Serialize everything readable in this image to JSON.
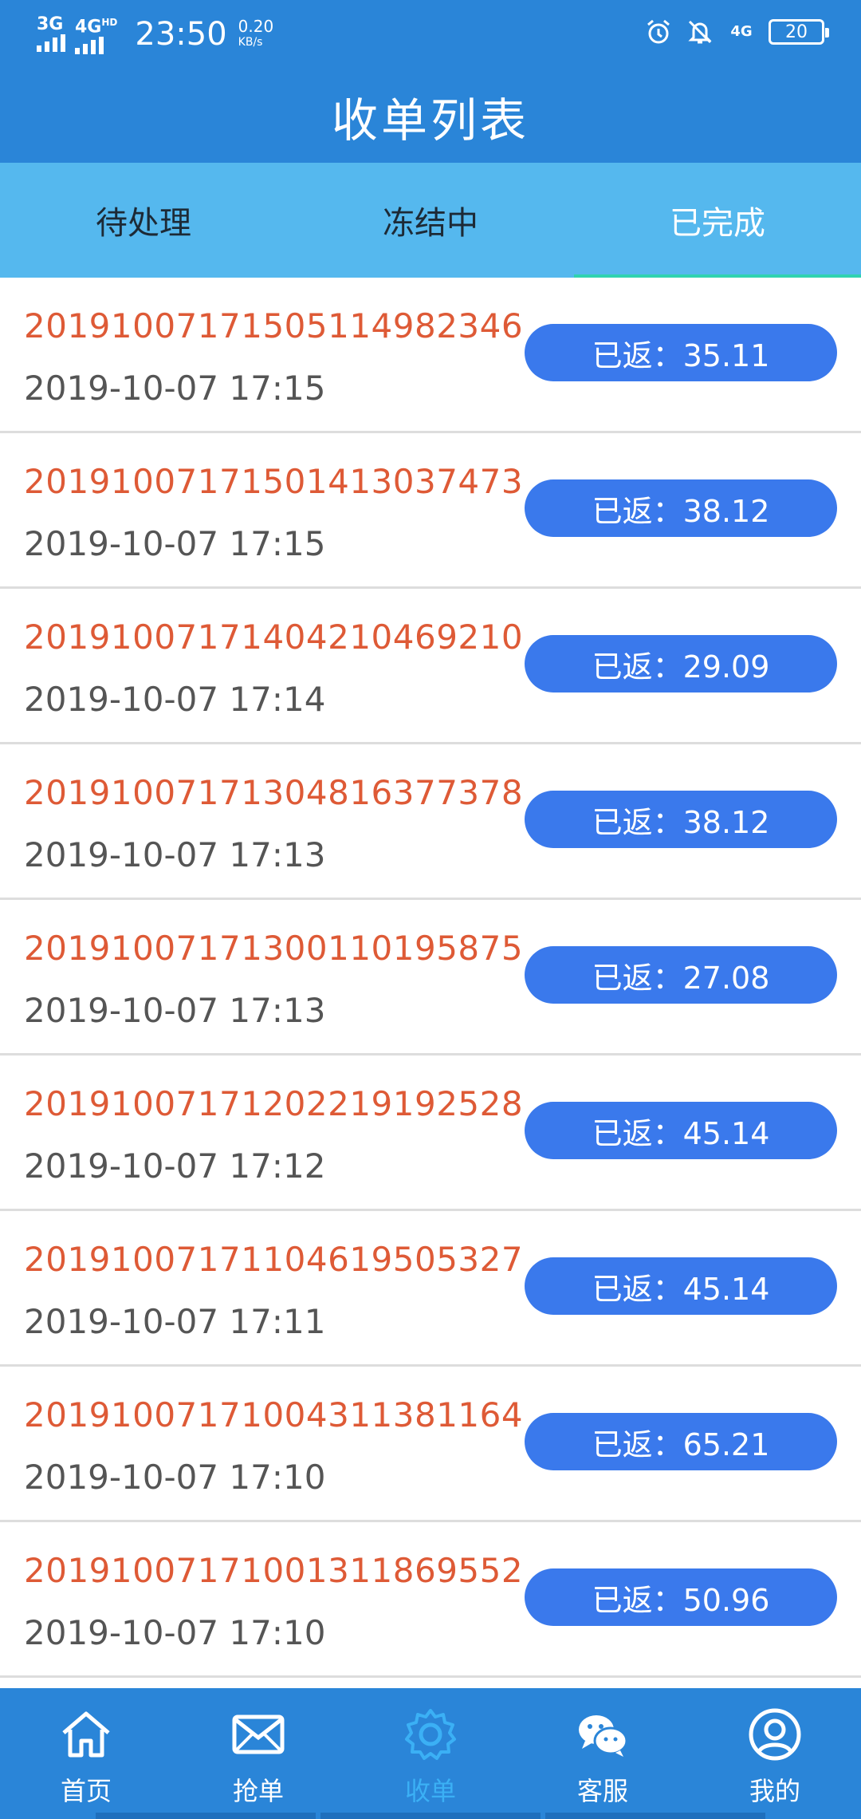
{
  "status_bar": {
    "signal1": "3G",
    "signal2": "4G",
    "signal2_sup": "HD",
    "time": "23:50",
    "speed_value": "0.20",
    "speed_unit": "KB/s",
    "net_label": "4G",
    "battery": "20",
    "icons": [
      "alarm-icon",
      "bell-off-icon",
      "network-icon",
      "battery-icon"
    ]
  },
  "header": {
    "title": "收单列表"
  },
  "tabs": [
    {
      "label": "待处理",
      "active": false
    },
    {
      "label": "冻结中",
      "active": false
    },
    {
      "label": "已完成",
      "active": true
    }
  ],
  "orders": [
    {
      "order_no": "20191007171505114982346",
      "time": "2019-10-07 17:15",
      "badge": "已返：35.11"
    },
    {
      "order_no": "20191007171501413037473",
      "time": "2019-10-07 17:15",
      "badge": "已返：38.12"
    },
    {
      "order_no": "20191007171404210469210",
      "time": "2019-10-07 17:14",
      "badge": "已返：29.09"
    },
    {
      "order_no": "20191007171304816377378",
      "time": "2019-10-07 17:13",
      "badge": "已返：38.12"
    },
    {
      "order_no": "20191007171300110195875",
      "time": "2019-10-07 17:13",
      "badge": "已返：27.08"
    },
    {
      "order_no": "20191007171202219192528",
      "time": "2019-10-07 17:12",
      "badge": "已返：45.14"
    },
    {
      "order_no": "20191007171104619505327",
      "time": "2019-10-07 17:11",
      "badge": "已返：45.14"
    },
    {
      "order_no": "20191007171004311381164",
      "time": "2019-10-07 17:10",
      "badge": "已返：65.21"
    },
    {
      "order_no": "20191007171001311869552",
      "time": "2019-10-07 17:10",
      "badge": "已返：50.96"
    }
  ],
  "bottom_nav": [
    {
      "label": "首页",
      "icon": "home-icon",
      "active": false
    },
    {
      "label": "抢单",
      "icon": "mail-icon",
      "active": false
    },
    {
      "label": "收单",
      "icon": "gear-icon",
      "active": true
    },
    {
      "label": "客服",
      "icon": "wechat-icon",
      "active": false
    },
    {
      "label": "我的",
      "icon": "user-icon",
      "active": false
    }
  ],
  "colors": {
    "header_bg": "#2a85d8",
    "tab_bg": "#55b8ee",
    "order_no": "#de5a36",
    "badge_bg": "#3a79ec",
    "nav_active": "#3bb0f5",
    "tab_indicator": "#2fd3b0"
  }
}
